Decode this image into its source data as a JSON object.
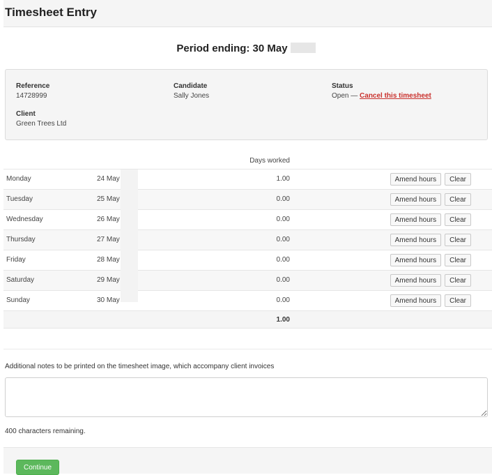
{
  "header": {
    "title": "Timesheet Entry"
  },
  "period": {
    "label": "Period ending: 30 May"
  },
  "info": {
    "reference_label": "Reference",
    "reference_value": "14728999",
    "candidate_label": "Candidate",
    "candidate_value": "Sally Jones",
    "status_label": "Status",
    "status_value": "Open —",
    "cancel_link": "Cancel this timesheet",
    "client_label": "Client",
    "client_value": "Green Trees Ltd"
  },
  "table": {
    "column_header": "Days worked",
    "rows": [
      {
        "day": "Monday",
        "date": "24 May",
        "days": "1.00"
      },
      {
        "day": "Tuesday",
        "date": "25 May",
        "days": "0.00"
      },
      {
        "day": "Wednesday",
        "date": "26 May",
        "days": "0.00"
      },
      {
        "day": "Thursday",
        "date": "27 May",
        "days": "0.00"
      },
      {
        "day": "Friday",
        "date": "28 May",
        "days": "0.00"
      },
      {
        "day": "Saturday",
        "date": "29 May",
        "days": "0.00"
      },
      {
        "day": "Sunday",
        "date": "30 May",
        "days": "0.00"
      }
    ],
    "amend_label": "Amend hours",
    "clear_label": "Clear",
    "total": "1.00"
  },
  "notes": {
    "label": "Additional notes to be printed on the timesheet image, which accompany client invoices",
    "value": "",
    "remaining": "400 characters remaining."
  },
  "footer": {
    "continue_label": "Continue"
  },
  "colors": {
    "continue_bg": "#5cb85c",
    "cancel_link": "#c9302c"
  }
}
